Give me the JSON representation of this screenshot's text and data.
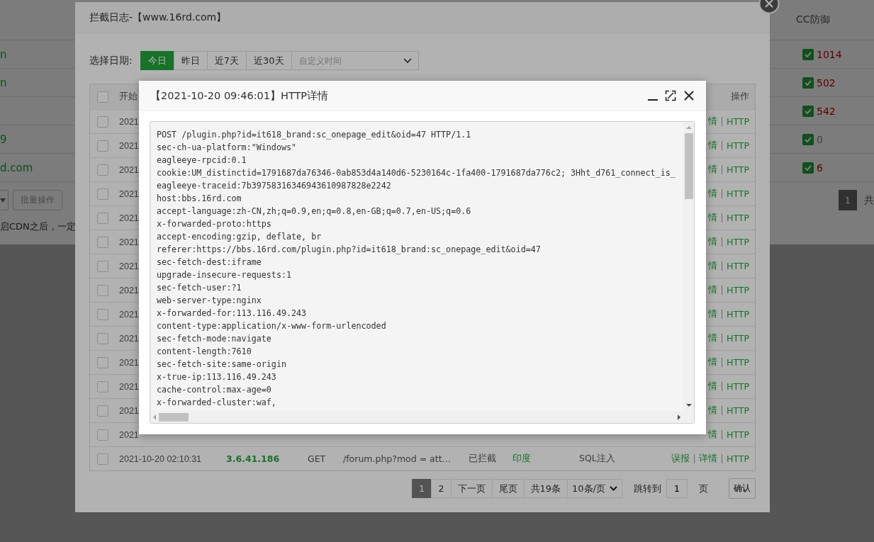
{
  "background_page": {
    "table": {
      "header": "CC防御",
      "rows": [
        {
          "site": "n",
          "cc_on": true,
          "cc_count": "1014",
          "count_alert": true
        },
        {
          "site": "n",
          "cc_on": true,
          "cc_count": "502",
          "count_alert": true
        },
        {
          "cc_on": true,
          "cc_count": "542",
          "count_alert": true
        },
        {
          "site": "9",
          "cc_on": true,
          "cc_count": "0",
          "count_alert": false
        },
        {
          "site": "d.com",
          "cc_on": true,
          "cc_count": "6",
          "count_alert": true
        }
      ]
    },
    "batch_button": "批量操作",
    "notice": "启CDN之后，一定",
    "pagination": {
      "pages": [
        {
          "label": "1",
          "selected": true
        }
      ],
      "summary": "共"
    }
  },
  "log_dialog": {
    "title": "拦截日志-【www.16rd.com】",
    "date_label": "选择日期:",
    "date_tabs": [
      {
        "label": "今日",
        "selected": true
      },
      {
        "label": "昨日",
        "selected": false
      },
      {
        "label": "近7天",
        "selected": false
      },
      {
        "label": "近30天",
        "selected": false
      }
    ],
    "custom_range": {
      "placeholder": "自定义时间"
    },
    "table": {
      "header": {
        "checked": false,
        "start_time": "开始",
        "actions": "操作"
      },
      "rows": [
        {
          "checked": false,
          "start_time": "2021",
          "actions": [
            {
              "label": "情"
            },
            {
              "label": "HTTP"
            }
          ]
        },
        {
          "checked": false,
          "start_time": "2021",
          "actions": [
            {
              "label": "情"
            },
            {
              "label": "HTTP"
            }
          ]
        },
        {
          "checked": false,
          "start_time": "2021",
          "actions": [
            {
              "label": "情"
            },
            {
              "label": "HTTP"
            }
          ]
        },
        {
          "checked": false,
          "start_time": "2021",
          "actions": [
            {
              "label": "情"
            },
            {
              "label": "HTTP"
            }
          ]
        },
        {
          "checked": false,
          "start_time": "2021",
          "actions": [
            {
              "label": "情"
            },
            {
              "label": "HTTP"
            }
          ]
        },
        {
          "checked": false,
          "start_time": "2021",
          "actions": [
            {
              "label": "情"
            },
            {
              "label": "HTTP"
            }
          ]
        },
        {
          "checked": false,
          "start_time": "2021",
          "actions": [
            {
              "label": "情"
            },
            {
              "label": "HTTP"
            }
          ]
        },
        {
          "checked": false,
          "start_time": "2021",
          "actions": [
            {
              "label": "情"
            },
            {
              "label": "HTTP"
            }
          ]
        },
        {
          "checked": false,
          "start_time": "2021",
          "actions": [
            {
              "label": "情"
            },
            {
              "label": "HTTP"
            }
          ]
        },
        {
          "checked": false,
          "start_time": "2021",
          "actions": [
            {
              "label": "情"
            },
            {
              "label": "HTTP"
            }
          ]
        },
        {
          "checked": false,
          "start_time": "2021",
          "actions": [
            {
              "label": "情"
            },
            {
              "label": "HTTP"
            }
          ]
        },
        {
          "checked": false,
          "start_time": "2021",
          "actions": [
            {
              "label": "情"
            },
            {
              "label": "HTTP"
            }
          ]
        },
        {
          "checked": false,
          "start_time": "2021",
          "actions": [
            {
              "label": "情"
            },
            {
              "label": "HTTP"
            }
          ]
        },
        {
          "checked": false,
          "start_time": "2021",
          "actions": [
            {
              "label": "情"
            },
            {
              "label": "HTTP"
            }
          ]
        },
        {
          "checked": false,
          "start_time": "2021-10-20 02:10:31",
          "ip": "3.6.41.186",
          "method": "GET",
          "url": "/forum.php?mod = att…",
          "status": "已拦截",
          "region": "印度",
          "attack_type": "SQL注入",
          "actions": [
            {
              "label": "误报"
            },
            {
              "label": "详情"
            },
            {
              "label": "HTTP"
            }
          ]
        }
      ]
    },
    "pagination": {
      "pages": [
        {
          "label": "1",
          "selected": true
        },
        {
          "label": "2",
          "selected": false
        }
      ],
      "next": "下一页",
      "last": "尾页",
      "total": "共19条",
      "page_size": "10条/页",
      "jump_label": "跳转到",
      "jump_value": "1",
      "page_unit": "页",
      "confirm": "确认"
    }
  },
  "detail_dialog": {
    "title": "【2021-10-20 09:46:01】HTTP详情",
    "lines": [
      "POST /plugin.php?id=it618_brand:sc_onepage_edit&oid=47 HTTP/1.1",
      "sec-ch-ua-platform:\"Windows\"",
      "eagleeye-rpcid:0.1",
      "cookie:UM_distinctid=1791687da76346-0ab853d4a140d6-5230164c-1fa400-1791687da776c2; 3Hht_d761_connect_is_",
      "eagleeye-traceid:7b39758316346943610987828e2242",
      "host:bbs.16rd.com",
      "accept-language:zh-CN,zh;q=0.9,en;q=0.8,en-GB;q=0.7,en-US;q=0.6",
      "x-forwarded-proto:https",
      "accept-encoding:gzip, deflate, br",
      "referer:https://bbs.16rd.com/plugin.php?id=it618_brand:sc_onepage_edit&oid=47",
      "sec-fetch-dest:iframe",
      "upgrade-insecure-requests:1",
      "sec-fetch-user:?1",
      "web-server-type:nginx",
      "x-forwarded-for:113.116.49.243",
      "content-type:application/x-www-form-urlencoded",
      "sec-fetch-mode:navigate",
      "content-length:7610",
      "sec-fetch-site:same-origin",
      "x-true-ip:113.116.49.243",
      "cache-control:max-age=0",
      "x-forwarded-cluster:waf,"
    ]
  }
}
